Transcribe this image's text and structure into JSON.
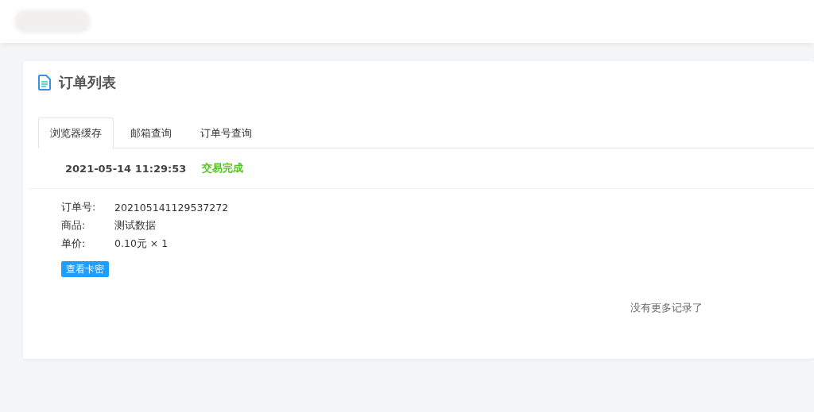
{
  "card": {
    "title": "订单列表"
  },
  "tabs": [
    {
      "label": "浏览器缓存",
      "selected": true
    },
    {
      "label": "邮箱查询",
      "selected": false
    },
    {
      "label": "订单号查询",
      "selected": false
    }
  ],
  "orders": [
    {
      "time": "2021-05-14 11:29:53",
      "status": "交易完成",
      "color": "#52c41a",
      "fields": [
        {
          "label": "订单号:",
          "value": "202105141129537272"
        },
        {
          "label": "商品:",
          "value": "测试数据"
        },
        {
          "label": "单价:",
          "value": "0.10元 × 1"
        }
      ],
      "button": "查看卡密"
    }
  ],
  "footer_note": "没有更多记录了"
}
